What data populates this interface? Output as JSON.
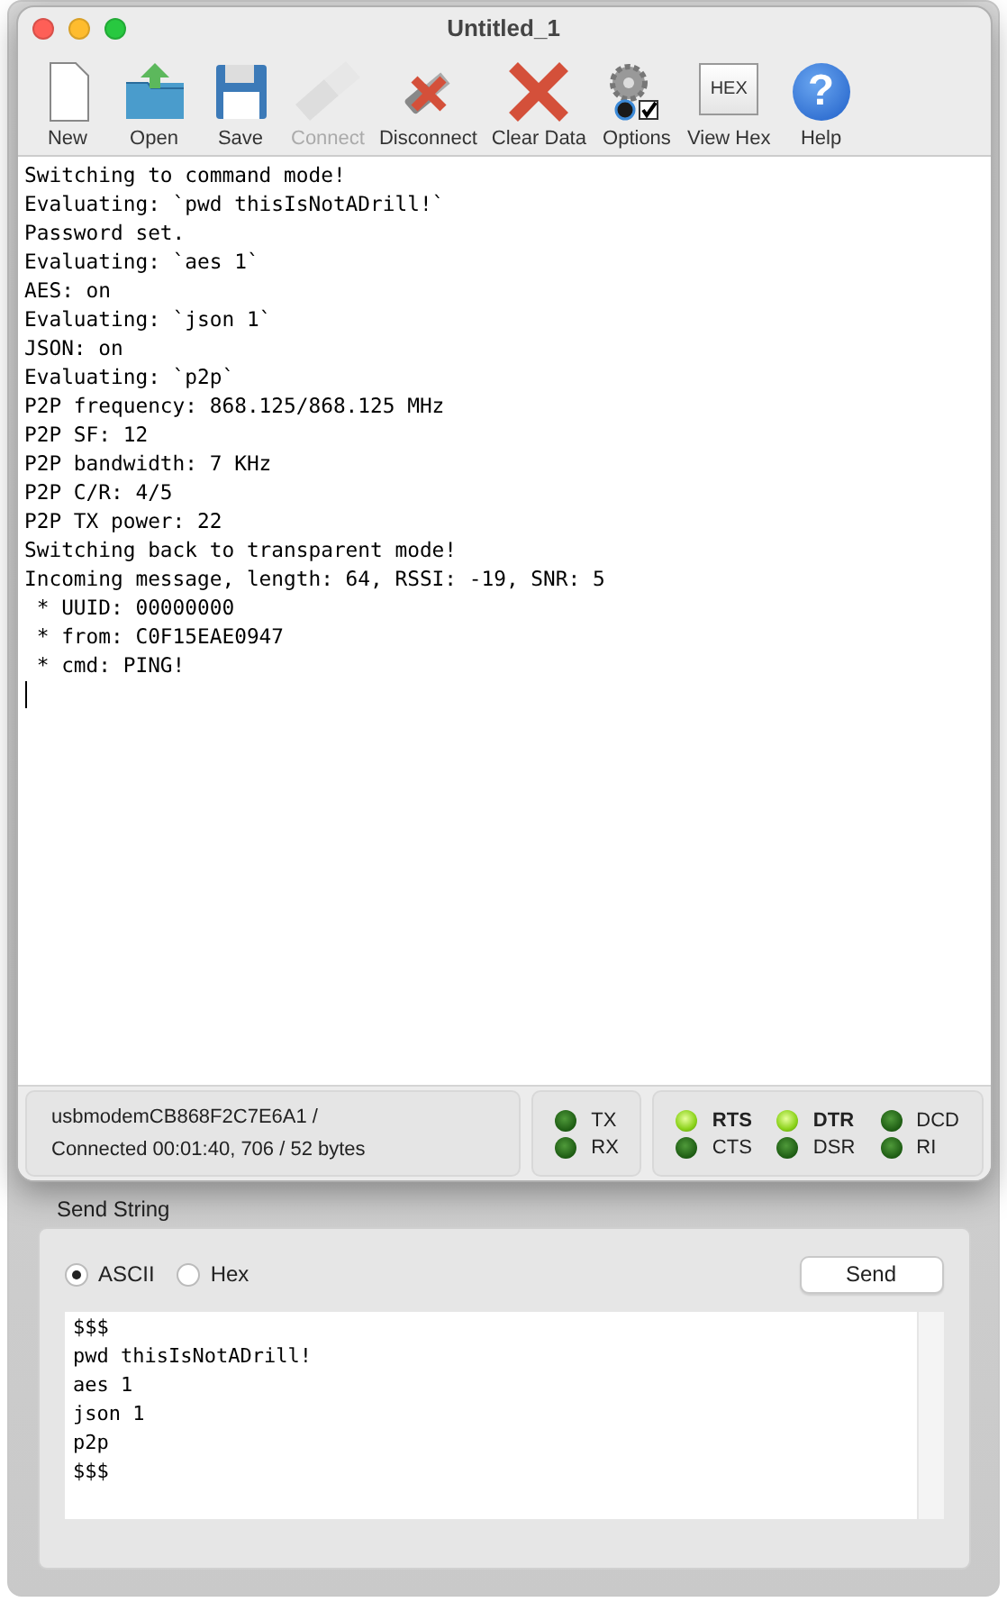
{
  "window": {
    "title": "Untitled_1"
  },
  "toolbar": [
    {
      "kind": "new",
      "label": "New",
      "disabled": false
    },
    {
      "kind": "open",
      "label": "Open",
      "disabled": false
    },
    {
      "kind": "save",
      "label": "Save",
      "disabled": false
    },
    {
      "kind": "connect",
      "label": "Connect",
      "disabled": true
    },
    {
      "kind": "disconnect",
      "label": "Disconnect",
      "disabled": false
    },
    {
      "kind": "clear",
      "label": "Clear Data",
      "disabled": false
    },
    {
      "kind": "options",
      "label": "Options",
      "disabled": false
    },
    {
      "kind": "hex",
      "label": "View Hex",
      "disabled": false,
      "icon_text": "HEX"
    },
    {
      "kind": "help",
      "label": "Help",
      "disabled": false,
      "icon_text": "?"
    }
  ],
  "terminal": {
    "lines": [
      "Switching to command mode!",
      "Evaluating: `pwd thisIsNotADrill!`",
      "Password set.",
      "Evaluating: `aes 1`",
      "AES: on",
      "Evaluating: `json 1`",
      "JSON: on",
      "Evaluating: `p2p`",
      "P2P frequency: 868.125/868.125 MHz",
      "P2P SF: 12",
      "P2P bandwidth: 7 KHz",
      "P2P C/R: 4/5",
      "P2P TX power: 22",
      "Switching back to transparent mode!",
      "Incoming message, length: 64, RSSI: -19, SNR: 5",
      " * UUID: 00000000",
      " * from: C0F15EAE0947",
      " * cmd: PING!"
    ]
  },
  "status_bar": {
    "port": "usbmodemCB868F2C7E6A1 /",
    "connection": "Connected 00:01:40, 706 / 52 bytes",
    "traffic_leds": [
      {
        "label": "TX",
        "on": false
      },
      {
        "label": "RX",
        "on": false
      }
    ],
    "line_leds": [
      {
        "label": "RTS",
        "on": true
      },
      {
        "label": "DTR",
        "on": true
      },
      {
        "label": "DCD",
        "on": false
      },
      {
        "label": "CTS",
        "on": false
      },
      {
        "label": "DSR",
        "on": false
      },
      {
        "label": "RI",
        "on": false
      }
    ]
  },
  "send_panel": {
    "title": "Send String",
    "modes": [
      {
        "label": "ASCII",
        "selected": true
      },
      {
        "label": "Hex",
        "selected": false
      }
    ],
    "send_button": "Send",
    "input_lines": [
      "$$$",
      "pwd thisIsNotADrill!",
      "aes 1",
      "json 1",
      "p2p",
      "$$$"
    ]
  }
}
